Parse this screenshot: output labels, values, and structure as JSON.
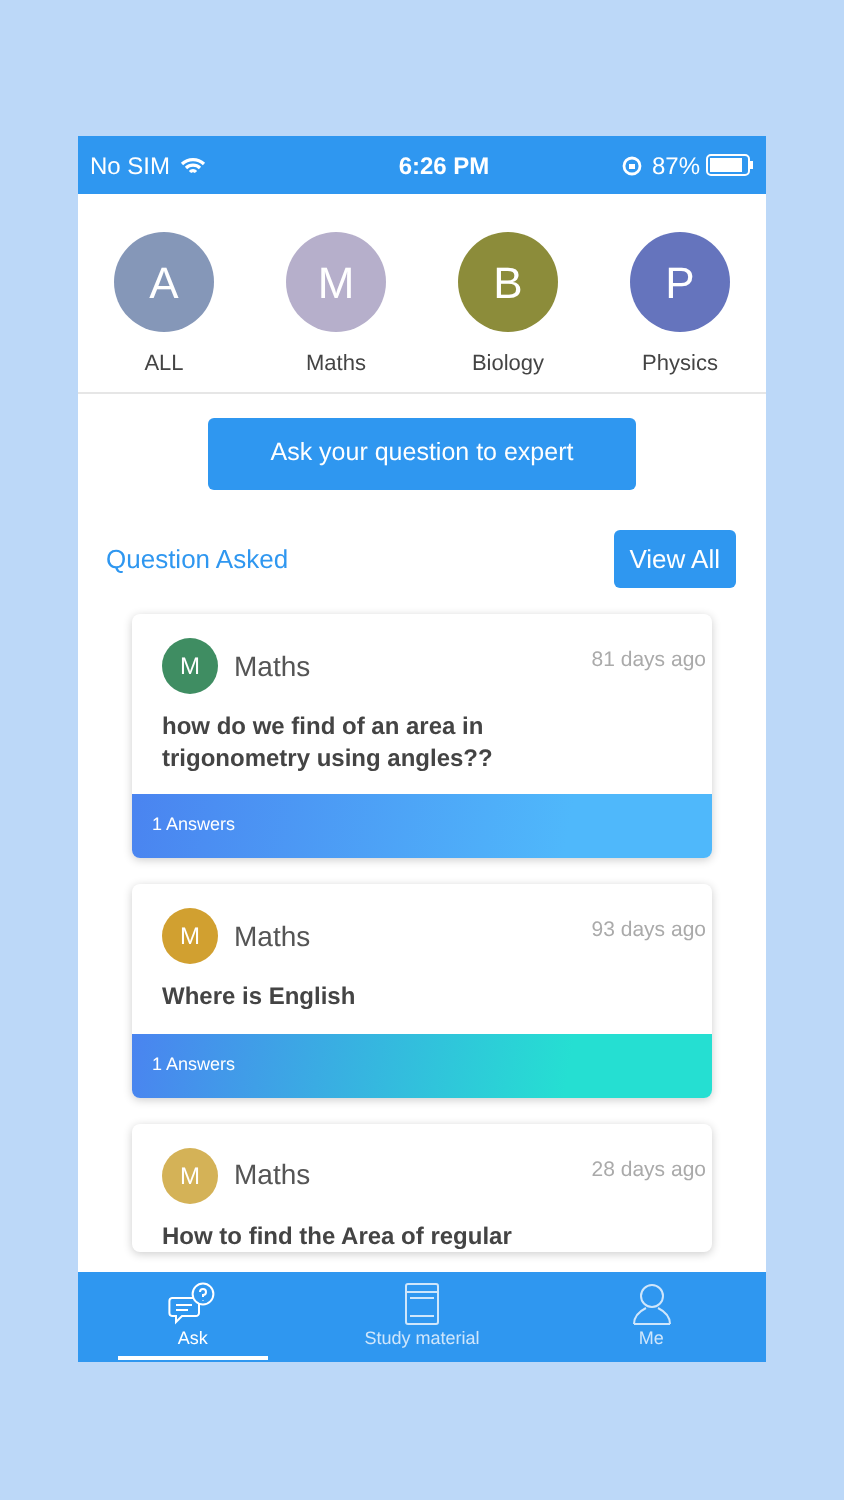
{
  "status_bar": {
    "carrier": "No SIM",
    "time": "6:26 PM",
    "battery": "87%"
  },
  "categories": [
    {
      "letter": "A",
      "label": "ALL",
      "color": "#8597b8"
    },
    {
      "letter": "M",
      "label": "Maths",
      "color": "#b6afcb"
    },
    {
      "letter": "B",
      "label": "Biology",
      "color": "#8c8c3a"
    },
    {
      "letter": "P",
      "label": "Physics",
      "color": "#6574bd"
    }
  ],
  "ask_button": "Ask your question to expert",
  "section": {
    "title": "Question Asked",
    "action": "View All"
  },
  "questions": [
    {
      "letter": "M",
      "subject": "Maths",
      "color": "#3f8d62",
      "age": "81 days ago",
      "text": "how do we find of an area in trigonometry using angles??",
      "answers": {
        "text": "1  Answers",
        "color": "#4fb8fb"
      }
    },
    {
      "letter": "M",
      "subject": "Maths",
      "color": "#d1a030",
      "age": "93 days ago",
      "text": "Where is English",
      "answers": {
        "text": "1  Answers",
        "color": "#25dfd2"
      }
    },
    {
      "letter": "M",
      "subject": "Maths",
      "color": "#d4b257",
      "age": "28 days ago",
      "text": "How to find the Area of regular"
    }
  ],
  "tabs": [
    {
      "label": "Ask",
      "selected": true
    },
    {
      "label": "Study material",
      "selected": false
    },
    {
      "label": "Me",
      "selected": false
    }
  ]
}
